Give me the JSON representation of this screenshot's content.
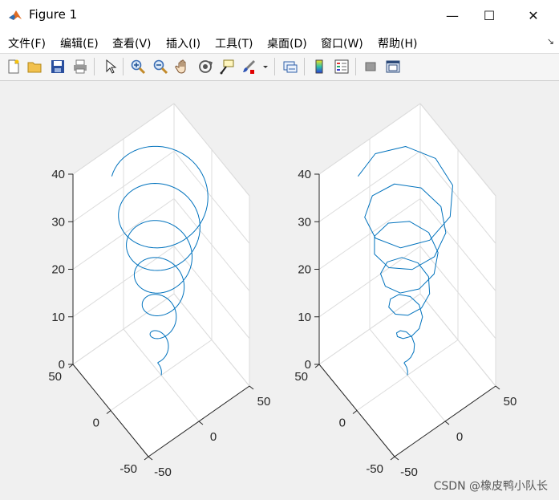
{
  "window": {
    "title": "Figure 1",
    "minimize_glyph": "—",
    "maximize_glyph": "☐",
    "close_glyph": "✕"
  },
  "menu": [
    {
      "id": "file",
      "label": "文件(F)"
    },
    {
      "id": "edit",
      "label": "编辑(E)"
    },
    {
      "id": "view",
      "label": "查看(V)"
    },
    {
      "id": "insert",
      "label": "插入(I)"
    },
    {
      "id": "tools",
      "label": "工具(T)"
    },
    {
      "id": "desktop",
      "label": "桌面(D)"
    },
    {
      "id": "window",
      "label": "窗口(W)"
    },
    {
      "id": "help",
      "label": "帮助(H)"
    }
  ],
  "menu_more_glyph": "↘",
  "toolbar": [
    {
      "id": "new",
      "icon": "new-figure-icon"
    },
    {
      "id": "open",
      "icon": "open-folder-icon"
    },
    {
      "id": "save",
      "icon": "save-icon"
    },
    {
      "id": "print",
      "icon": "print-icon"
    },
    {
      "id": "select",
      "icon": "pointer-icon"
    },
    {
      "id": "zoom-in",
      "icon": "zoom-in-icon"
    },
    {
      "id": "zoom-out",
      "icon": "zoom-out-icon"
    },
    {
      "id": "pan",
      "icon": "pan-hand-icon"
    },
    {
      "id": "rotate",
      "icon": "rotate-3d-icon"
    },
    {
      "id": "datatip",
      "icon": "data-cursor-icon"
    },
    {
      "id": "brush",
      "icon": "brush-icon"
    },
    {
      "id": "link",
      "icon": "link-plot-icon"
    },
    {
      "id": "colorbar",
      "icon": "colorbar-icon"
    },
    {
      "id": "legend",
      "icon": "legend-icon"
    },
    {
      "id": "hide-tools",
      "icon": "hide-plot-tools-icon"
    },
    {
      "id": "show-tools",
      "icon": "show-plot-tools-icon"
    }
  ],
  "colors": {
    "line": "#0072BD",
    "axis": "#262626",
    "grid": "#dcdcdc",
    "background": "#f0f0f0",
    "axes_bg": "#ffffff"
  },
  "chart_data": [
    {
      "type": "line",
      "subtype": "3d-helix",
      "title": "",
      "xlabel": "",
      "ylabel": "",
      "zlabel": "",
      "xlim": [
        -50,
        50
      ],
      "ylim": [
        -50,
        50
      ],
      "zlim": [
        0,
        40
      ],
      "xticks": [
        "-50",
        "0",
        "50"
      ],
      "yticks": [
        "-50",
        "0",
        "50"
      ],
      "zticks": [
        "0",
        "10",
        "20",
        "30",
        "40"
      ],
      "grid": true,
      "series": [
        {
          "name": "",
          "t_range": [
            0,
            40
          ],
          "x": "t*cos(t)",
          "y": "t*sin(t)",
          "z": "t",
          "samples": 400
        }
      ]
    },
    {
      "type": "line",
      "subtype": "3d-helix",
      "title": "",
      "xlabel": "",
      "ylabel": "",
      "zlabel": "",
      "xlim": [
        -50,
        50
      ],
      "ylim": [
        -50,
        50
      ],
      "zlim": [
        0,
        40
      ],
      "xticks": [
        "-50",
        "0",
        "50"
      ],
      "yticks": [
        "-50",
        "0",
        "50"
      ],
      "zticks": [
        "0",
        "10",
        "20",
        "30",
        "40"
      ],
      "grid": true,
      "series": [
        {
          "name": "",
          "t_range": [
            0,
            40
          ],
          "x": "t*cos(t)",
          "y": "t*sin(t)",
          "z": "t",
          "samples": 60
        }
      ]
    }
  ],
  "watermark": "CSDN @橡皮鸭小队长"
}
